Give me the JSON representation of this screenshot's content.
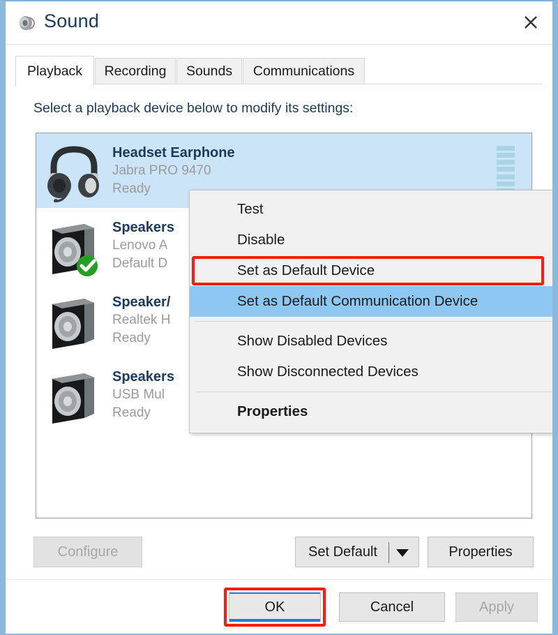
{
  "window": {
    "title": "Sound",
    "icon": "speaker-icon",
    "close_icon": "close-icon"
  },
  "tabs": [
    {
      "label": "Playback",
      "active": true
    },
    {
      "label": "Recording",
      "active": false
    },
    {
      "label": "Sounds",
      "active": false
    },
    {
      "label": "Communications",
      "active": false
    }
  ],
  "instruction": "Select a playback device below to modify its settings:",
  "devices": [
    {
      "name": "Headset Earphone",
      "driver": "Jabra PRO 9470",
      "status": "Ready",
      "icon": "headset-icon",
      "selected": true,
      "default": false,
      "meter_segments": 8
    },
    {
      "name": "Speakers",
      "driver": "Lenovo A",
      "status": "Default D",
      "icon": "speaker-box-icon",
      "selected": false,
      "default": true,
      "meter_segments": 0
    },
    {
      "name": "Speaker/",
      "driver": "Realtek H",
      "status": "Ready",
      "icon": "speaker-box-icon",
      "selected": false,
      "default": false,
      "meter_segments": 0
    },
    {
      "name": "Speakers",
      "driver": "USB Mul",
      "status": "Ready",
      "icon": "speaker-box-icon",
      "selected": false,
      "default": false,
      "meter_segments": 0
    }
  ],
  "context_menu": {
    "items": [
      {
        "label": "Test",
        "bold": false,
        "highlighted": false,
        "separator_after": false
      },
      {
        "label": "Disable",
        "bold": false,
        "highlighted": false,
        "separator_after": false
      },
      {
        "label": "Set as Default Device",
        "bold": false,
        "highlighted": false,
        "separator_after": false
      },
      {
        "label": "Set as Default Communication Device",
        "bold": false,
        "highlighted": true,
        "separator_after": true
      },
      {
        "label": "Show Disabled Devices",
        "bold": false,
        "highlighted": false,
        "separator_after": false
      },
      {
        "label": "Show Disconnected Devices",
        "bold": false,
        "highlighted": false,
        "separator_after": true
      },
      {
        "label": "Properties",
        "bold": true,
        "highlighted": false,
        "separator_after": false
      }
    ]
  },
  "mid_buttons": {
    "configure": "Configure",
    "configure_disabled": true,
    "set_default": "Set Default",
    "set_default_arrow": "chevron-down-icon",
    "properties": "Properties"
  },
  "footer_buttons": {
    "ok": "OK",
    "cancel": "Cancel",
    "apply": "Apply",
    "apply_disabled": true
  },
  "annotations": {
    "highlight_color": "#ff1a12",
    "menu_highlight_color": "#8dc8f2",
    "selection_color": "#cce4f7",
    "default_badge_color": "#22a024"
  }
}
